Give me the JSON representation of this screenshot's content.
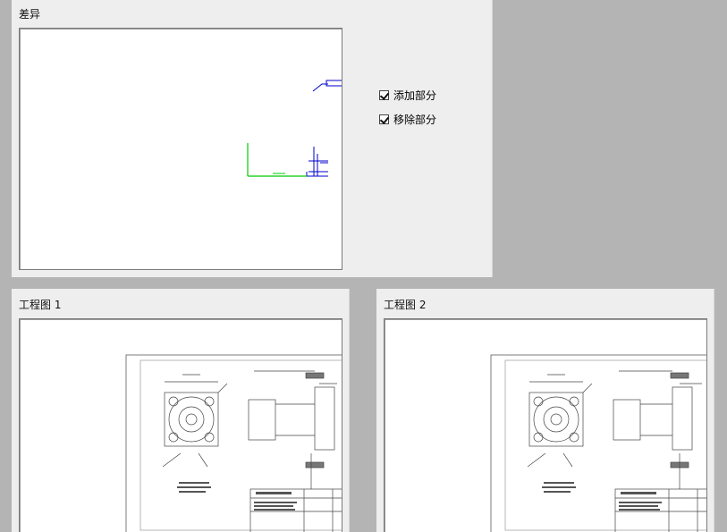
{
  "diff_panel": {
    "title": "差异",
    "options": [
      {
        "label": "添加部分",
        "checked": true
      },
      {
        "label": "移除部分",
        "checked": true
      }
    ]
  },
  "drawing1": {
    "title": "工程图 1"
  },
  "drawing2": {
    "title": "工程图 2"
  },
  "colors": {
    "added": "#00cc00",
    "removed": "#0000cc"
  }
}
